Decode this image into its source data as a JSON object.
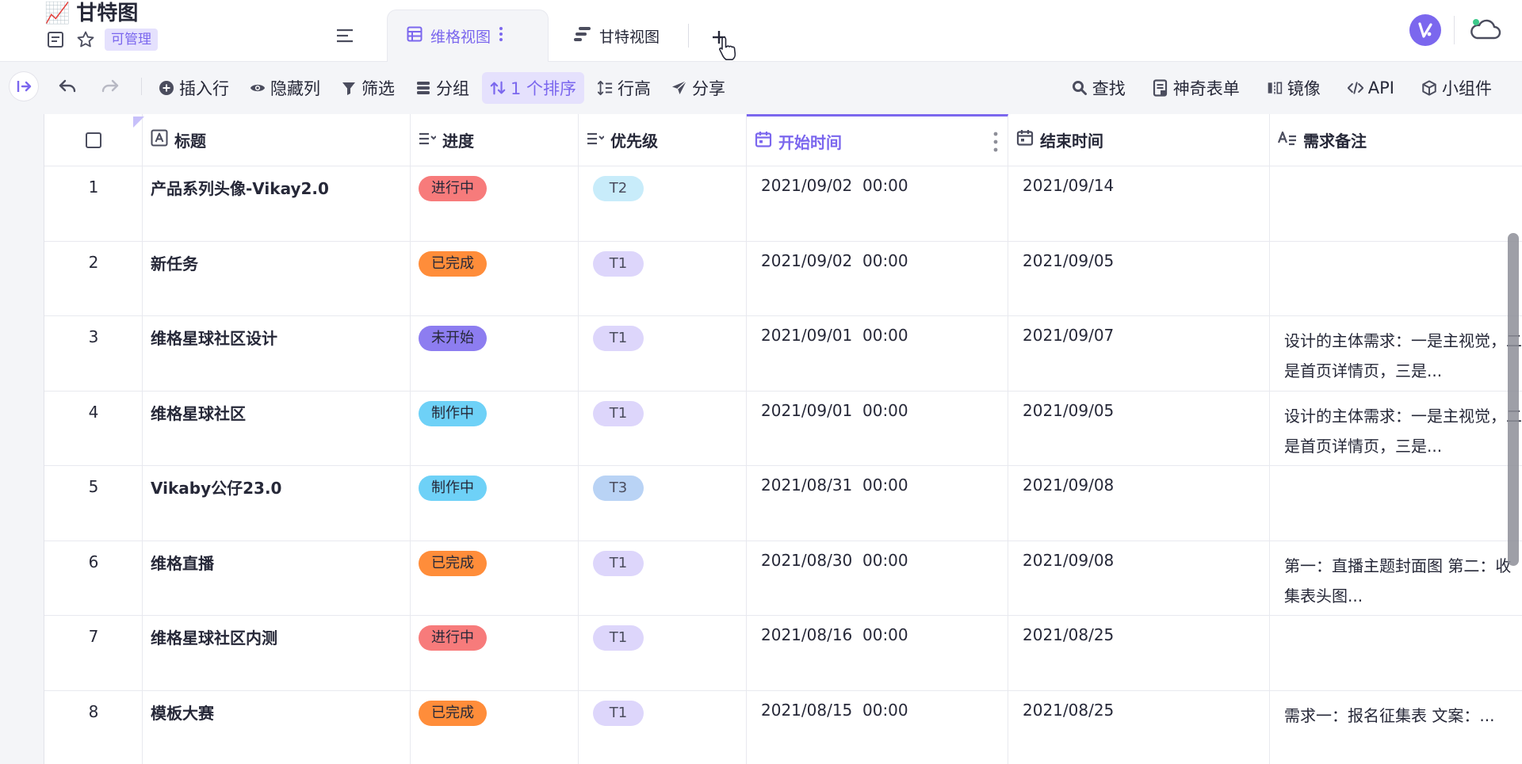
{
  "header": {
    "emoji": "📈",
    "title": "甘特图",
    "permission": "可管理",
    "tabs": [
      {
        "label": "维格视图",
        "active": true
      },
      {
        "label": "甘特视图",
        "active": false
      }
    ]
  },
  "toolbar": {
    "left_items": [
      {
        "label": "插入行",
        "icon": "plus-circle-icon"
      },
      {
        "label": "隐藏列",
        "icon": "eye-icon"
      },
      {
        "label": "筛选",
        "icon": "filter-icon"
      },
      {
        "label": "分组",
        "icon": "group-icon"
      },
      {
        "label": "1 个排序",
        "icon": "sort-icon",
        "active": true
      },
      {
        "label": "行高",
        "icon": "row-height-icon"
      },
      {
        "label": "分享",
        "icon": "share-icon"
      }
    ],
    "right_items": [
      {
        "label": "查找",
        "icon": "search-icon"
      },
      {
        "label": "神奇表单",
        "icon": "form-icon"
      },
      {
        "label": "镜像",
        "icon": "mirror-icon"
      },
      {
        "label": "API",
        "icon": "code-icon"
      },
      {
        "label": "小组件",
        "icon": "widget-icon"
      }
    ]
  },
  "columns": {
    "title": "标题",
    "progress": "进度",
    "priority": "优先级",
    "start": "开始时间",
    "end": "结束时间",
    "note": "需求备注"
  },
  "rows": [
    {
      "num": "1",
      "title": "产品系列头像-Vikay2.0",
      "status": "进行中",
      "status_color": "#f77b7b",
      "priority": "T2",
      "priority_color": "#c8ecfa",
      "start": "2021/09/02  00:00",
      "end": "2021/09/14",
      "note": "",
      "thumb": "white"
    },
    {
      "num": "2",
      "title": "新任务",
      "status": "已完成",
      "status_color": "#ff8d3a",
      "priority": "T1",
      "priority_color": "#ddd6fb",
      "start": "2021/09/02  00:00",
      "end": "2021/09/05",
      "note": "",
      "thumb": ""
    },
    {
      "num": "3",
      "title": "维格星球社区设计",
      "status": "未开始",
      "status_color": "#8d7df0",
      "priority": "T1",
      "priority_color": "#ddd6fb",
      "start": "2021/09/01  00:00",
      "end": "2021/09/07",
      "note": "设计的主体需求：一是主视觉，二是首页详情页，三是...",
      "thumb": "purple"
    },
    {
      "num": "4",
      "title": "维格星球社区",
      "status": "制作中",
      "status_color": "#6ed1f7",
      "priority": "T1",
      "priority_color": "#ddd6fb",
      "start": "2021/09/01  00:00",
      "end": "2021/09/05",
      "note": "设计的主体需求：一是主视觉，二是首页详情页，三是...",
      "thumb": "white"
    },
    {
      "num": "5",
      "title": "Vikaby公仔23.0",
      "status": "制作中",
      "status_color": "#6ed1f7",
      "priority": "T3",
      "priority_color": "#b9d3f5",
      "start": "2021/08/31  00:00",
      "end": "2021/09/08",
      "note": "",
      "thumb": ""
    },
    {
      "num": "6",
      "title": "维格直播",
      "status": "已完成",
      "status_color": "#ff8d3a",
      "priority": "T1",
      "priority_color": "#ddd6fb",
      "start": "2021/08/30  00:00",
      "end": "2021/09/08",
      "note": "第一：直播主题封面图 第二：收集表头图...",
      "thumb": "white"
    },
    {
      "num": "7",
      "title": "维格星球社区内测",
      "status": "进行中",
      "status_color": "#f77b7b",
      "priority": "T1",
      "priority_color": "#ddd6fb",
      "start": "2021/08/16  00:00",
      "end": "2021/08/25",
      "note": "",
      "thumb": "purple"
    },
    {
      "num": "8",
      "title": "模板大赛",
      "status": "已完成",
      "status_color": "#ff8d3a",
      "priority": "T1",
      "priority_color": "#ddd6fb",
      "start": "2021/08/15  00:00",
      "end": "2021/08/25",
      "note": "需求一：报名征集表 文案：...",
      "thumb": "white"
    }
  ],
  "colors": {
    "accent": "#7b67ee",
    "accent_light": "#e5e1fd",
    "toolbar_bg": "#f4f5f8"
  }
}
